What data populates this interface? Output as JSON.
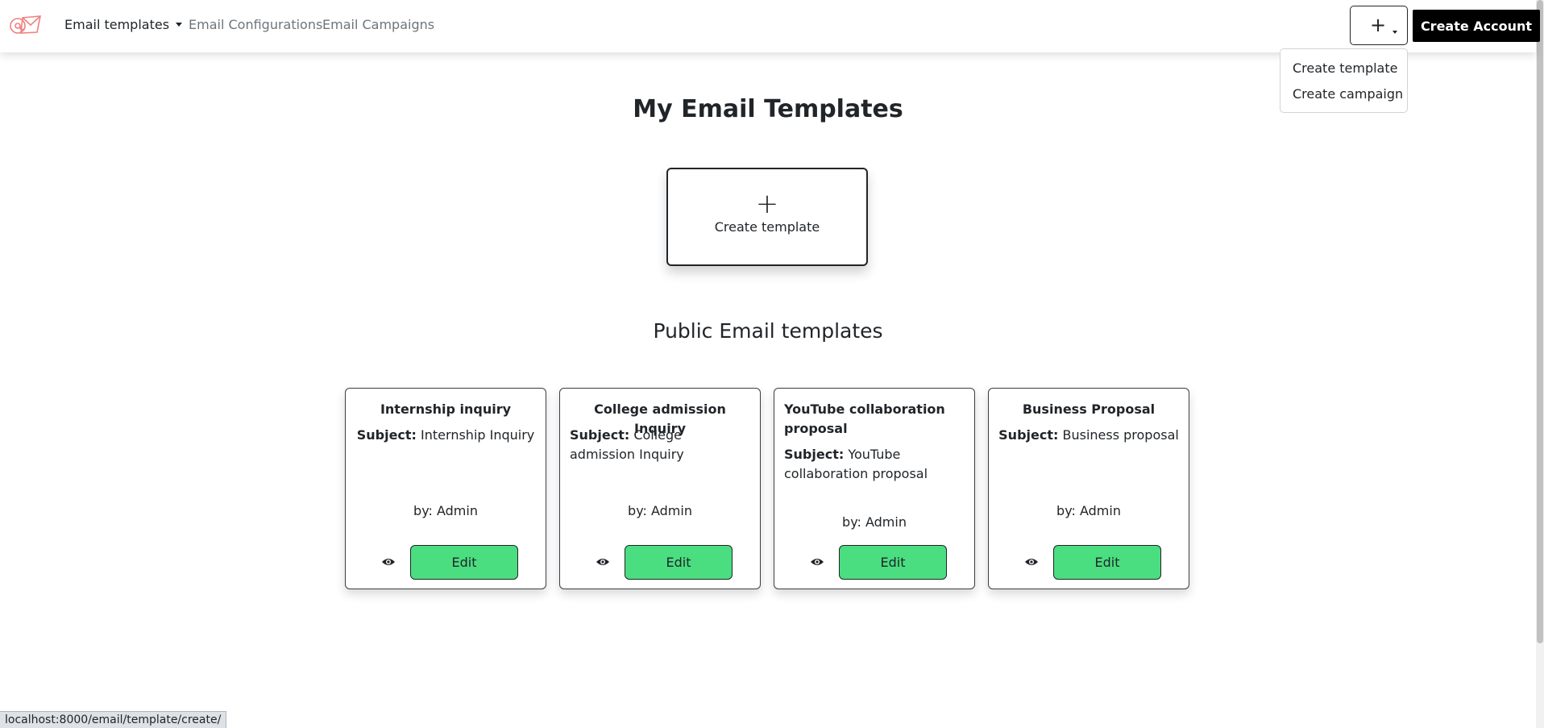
{
  "nav": {
    "logo_icon": "email-logo-icon",
    "links": [
      {
        "label": "Email templates",
        "active": true,
        "has_dropdown": true
      },
      {
        "label": "Email Configurations",
        "active": false
      },
      {
        "label": "Email Campaigns",
        "active": false
      }
    ],
    "plus_button_label": "+",
    "create_account_label": "Create Account",
    "dropdown": {
      "items": [
        "Create template",
        "Create campaign"
      ]
    }
  },
  "main": {
    "title": "My Email Templates",
    "create_card": {
      "icon": "plus-icon",
      "label": "Create template"
    },
    "public_title": "Public Email templates",
    "subject_prefix": "Subject:",
    "edit_label": "Edit",
    "view_icon": "eye-icon",
    "templates": [
      {
        "title": "Internship inquiry",
        "subject": "Internship Inquiry",
        "author": "by: Admin"
      },
      {
        "title": "College admission Inquiry",
        "subject": "College admission Inquiry",
        "author": "by: Admin"
      },
      {
        "title": "YouTube collaboration proposal",
        "subject": "YouTube collaboration proposal",
        "author": "by: Admin"
      },
      {
        "title": "Business Proposal",
        "subject": "Business proposal",
        "author": "by: Admin"
      }
    ]
  },
  "status_bar": {
    "url": "localhost:8000/email/template/create/"
  },
  "colors": {
    "edit_button": "#4ade80",
    "primary_dark": "#000000"
  }
}
